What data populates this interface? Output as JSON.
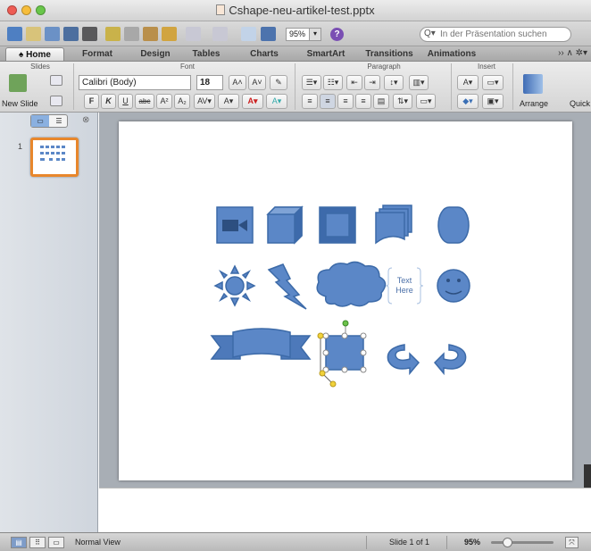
{
  "window": {
    "title": "Cshape-neu-artikel-test.pptx"
  },
  "toolbar": {
    "zoom_value": "95%",
    "search_placeholder": "In der Präsentation suchen"
  },
  "ribbon_tabs": [
    "Home",
    "Format",
    "Design",
    "Tables",
    "Charts",
    "SmartArt",
    "Transitions",
    "Animations"
  ],
  "ribbon": {
    "groups": {
      "slides": "Slides",
      "font": "Font",
      "paragraph": "Paragraph",
      "insert": "Insert"
    },
    "new_slide_label": "New Slide",
    "font_name": "Calibri (Body)",
    "font_size": "18",
    "bold": "F",
    "italic": "K",
    "underline": "U",
    "strikethrough": "abc",
    "superscript": "A²",
    "subscript": "A₂",
    "arrange_label": "Arrange",
    "quick_styles_label": "Quick"
  },
  "slides_pane": {
    "thumb_number": "1"
  },
  "slide": {
    "textbox_text": [
      "Text",
      "Here"
    ]
  },
  "statusbar": {
    "view_label": "Normal View",
    "slide_counter": "Slide 1 of 1",
    "zoom": "95%"
  },
  "colors": {
    "shape_fill": "#5b87c7",
    "shape_stroke": "#3c6aa8",
    "selection_orange": "#e8872c",
    "adjust_handle": "#f1d23a"
  }
}
